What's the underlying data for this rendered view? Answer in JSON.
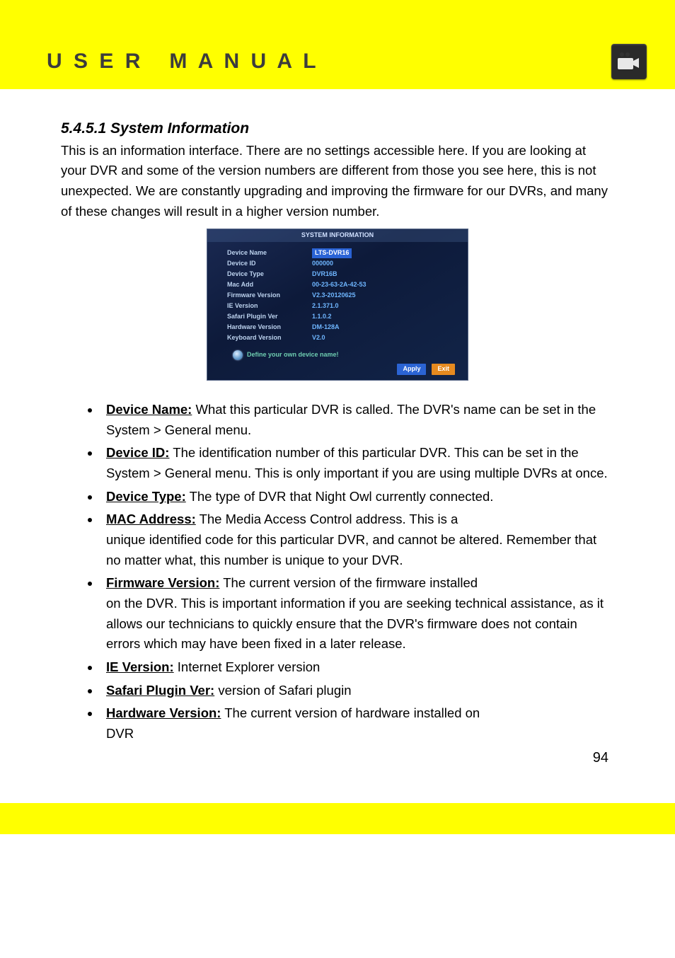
{
  "header": {
    "title": "U S E R   M A N U A L"
  },
  "section": {
    "heading": "5.4.5.1 System Information",
    "intro": "This is an information interface. There are no settings accessible here. If you are looking at your DVR and some of the version numbers are different from those you see here, this is not unexpected. We are constantly upgrading and improving the firmware for our DVRs, and many of these changes will result in a higher version number."
  },
  "screenshot": {
    "title": "SYSTEM INFORMATION",
    "rows": [
      {
        "label": "Device Name",
        "value": "LTS-DVR16",
        "selected": true
      },
      {
        "label": "Device ID",
        "value": "000000"
      },
      {
        "label": "Device Type",
        "value": "DVR16B"
      },
      {
        "label": "Mac Add",
        "value": "00-23-63-2A-42-53"
      },
      {
        "label": "Firmware Version",
        "value": "V2.3-20120625"
      },
      {
        "label": "IE   Version",
        "value": "2.1.371.0"
      },
      {
        "label": "Safari Plugin Ver",
        "value": "1.1.0.2"
      },
      {
        "label": "Hardware Version",
        "value": "DM-128A"
      },
      {
        "label": "Keyboard Version",
        "value": "V2.0"
      }
    ],
    "tip": "Define your own device name!",
    "apply": "Apply",
    "exit": "Exit"
  },
  "bullets": [
    {
      "term": "Device Name:",
      "text": " What this particular DVR is called. The DVR's name can be set in the System > General menu.",
      "cont": ""
    },
    {
      "term": "Device ID:",
      "text": " The identification number of this particular DVR. This can be set in the System > General menu. This is only important if you are using multiple DVRs at once.",
      "cont": ""
    },
    {
      "term": "Device Type:",
      "text": " The type of DVR that Night Owl currently connected.",
      "cont": ""
    },
    {
      "term": "MAC Address:",
      "text": " The Media Access Control address. This is a",
      "cont": "unique identified code for this particular DVR, and cannot be altered. Remember that no matter what, this number is unique to your DVR."
    },
    {
      "term": "Firmware Version:",
      "text": " The current version of the firmware installed",
      "cont": "on the DVR. This is important information if you are seeking technical assistance, as it allows our technicians to quickly ensure that the DVR's firmware does not contain errors which may have been fixed in a later release."
    },
    {
      "term": "IE Version:",
      "text": " Internet Explorer version",
      "cont": ""
    },
    {
      "term": "Safari Plugin Ver:",
      "text": " version of Safari plugin",
      "cont": ""
    },
    {
      "term": "Hardware Version:",
      "text": " The current version of hardware installed on",
      "cont": "DVR"
    }
  ],
  "page_number": "94"
}
